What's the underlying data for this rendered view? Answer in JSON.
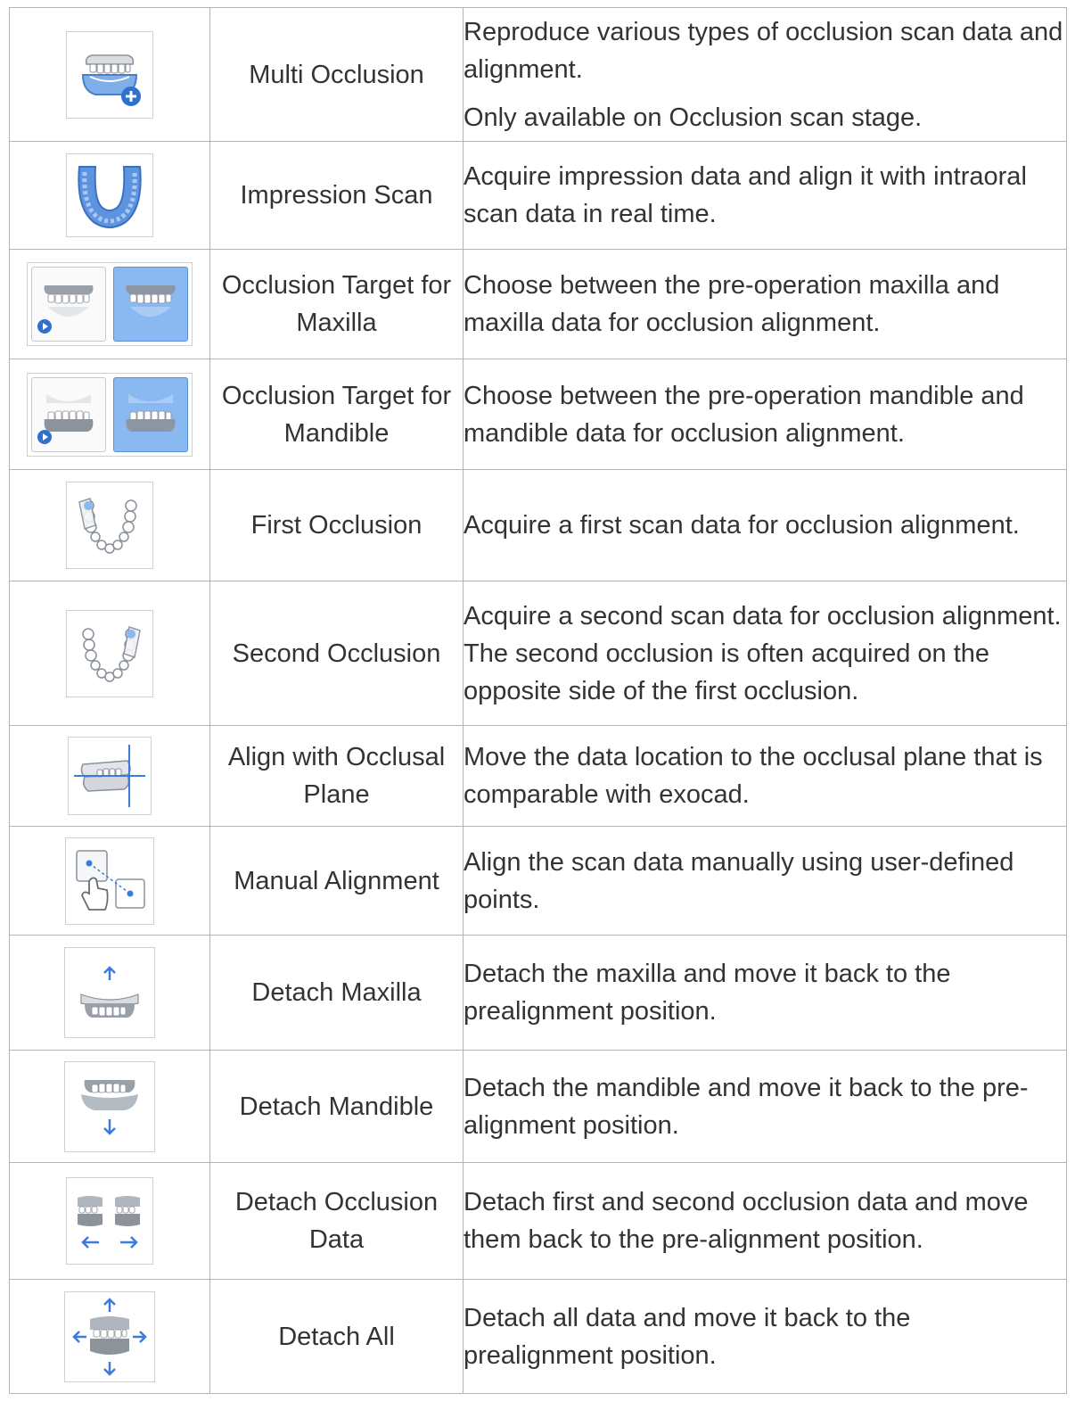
{
  "accent_color": "#4a90e2",
  "rows": [
    {
      "icon": "multi-occlusion-icon",
      "name": "Multi Occlusion",
      "desc": [
        "Reproduce various types of occlusion scan data and alignment.",
        "Only available on Occlusion scan stage."
      ]
    },
    {
      "icon": "impression-scan-icon",
      "name": "Impression Scan",
      "desc": [
        "Acquire impression data and align it with intraoral scan data in real time."
      ]
    },
    {
      "icon": "occlusion-target-maxilla-icon",
      "name": "Occlusion Target for Maxilla",
      "desc": [
        "Choose between the pre-operation maxilla and maxilla data for occlusion alignment."
      ]
    },
    {
      "icon": "occlusion-target-mandible-icon",
      "name": "Occlusion Target for Mandible",
      "desc": [
        "Choose between the pre-operation mandible and mandible data for occlusion alignment."
      ]
    },
    {
      "icon": "first-occlusion-icon",
      "name": "First Occlusion",
      "desc": [
        "Acquire a first scan data for occlusion alignment."
      ]
    },
    {
      "icon": "second-occlusion-icon",
      "name": "Second Occlusion",
      "desc": [
        "Acquire a second scan data for occlusion alignment. The second occlusion is often acquired on the opposite side of the first occlusion."
      ]
    },
    {
      "icon": "align-occlusal-plane-icon",
      "name": "Align with Occlusal Plane",
      "desc": [
        "Move the data location to the occlusal plane that is comparable with exocad."
      ]
    },
    {
      "icon": "manual-alignment-icon",
      "name": "Manual Alignment",
      "desc": [
        "Align the scan data manually using user-defined points."
      ]
    },
    {
      "icon": "detach-maxilla-icon",
      "name": "Detach Maxilla",
      "desc": [
        "Detach the maxilla and move it back to the prealignment position."
      ]
    },
    {
      "icon": "detach-mandible-icon",
      "name": "Detach Mandible",
      "desc": [
        "Detach the mandible and move it back to the pre-alignment position."
      ]
    },
    {
      "icon": "detach-occlusion-data-icon",
      "name": "Detach Occlusion Data",
      "desc": [
        "Detach first and second occlusion data and move them back to the pre-alignment position."
      ]
    },
    {
      "icon": "detach-all-icon",
      "name": "Detach All",
      "desc": [
        "Detach all data and move it back to the prealignment position."
      ]
    }
  ]
}
